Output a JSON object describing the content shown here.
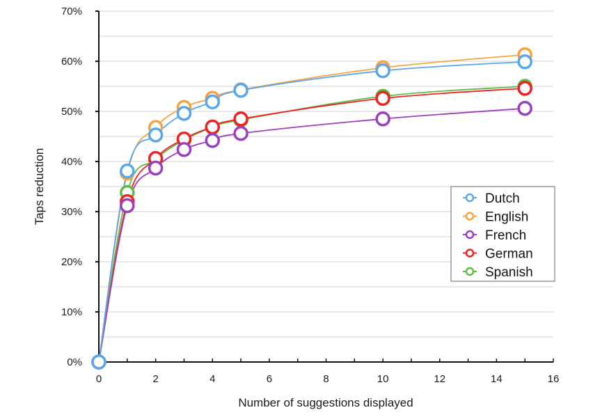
{
  "chart_data": {
    "type": "line",
    "title": "",
    "xlabel": "Number of suggestions displayed",
    "ylabel": "Taps reduction",
    "xlim": [
      0,
      16
    ],
    "ylim": [
      0,
      70
    ],
    "x_ticks": [
      0,
      2,
      4,
      6,
      8,
      10,
      12,
      14,
      16
    ],
    "x_tick_labels": [
      "0",
      "2",
      "4",
      "6",
      "8",
      "10",
      "12",
      "14",
      "16"
    ],
    "x_minor_step": 1,
    "y_ticks": [
      0,
      10,
      20,
      30,
      40,
      50,
      60,
      70
    ],
    "y_tick_labels": [
      "0%",
      "10%",
      "20%",
      "30%",
      "40%",
      "50%",
      "60%",
      "70%"
    ],
    "y_minor_step": 5,
    "grid": true,
    "legend_position": "right-middle",
    "x": [
      0,
      1,
      2,
      3,
      4,
      5,
      10,
      15
    ],
    "series": [
      {
        "name": "Dutch",
        "color": "#5aa6ec",
        "values": [
          0,
          38.1,
          45.3,
          49.6,
          51.9,
          54.2,
          58.1,
          59.9
        ]
      },
      {
        "name": "English",
        "color": "#f6a33f",
        "values": [
          0,
          37.7,
          46.8,
          50.8,
          52.6,
          54.3,
          58.7,
          61.3
        ]
      },
      {
        "name": "French",
        "color": "#9a3fbf",
        "values": [
          0,
          31.2,
          38.7,
          42.4,
          44.2,
          45.6,
          48.5,
          50.6
        ]
      },
      {
        "name": "German",
        "color": "#ee2222",
        "values": [
          0,
          32.0,
          40.6,
          44.5,
          46.9,
          48.5,
          52.6,
          54.6
        ]
      },
      {
        "name": "Spanish",
        "color": "#5fba46",
        "values": [
          0,
          33.8,
          40.4,
          44.3,
          46.8,
          48.3,
          53.0,
          55.0
        ]
      }
    ],
    "draw_order": [
      "Spanish",
      "German",
      "French",
      "English",
      "Dutch"
    ]
  }
}
